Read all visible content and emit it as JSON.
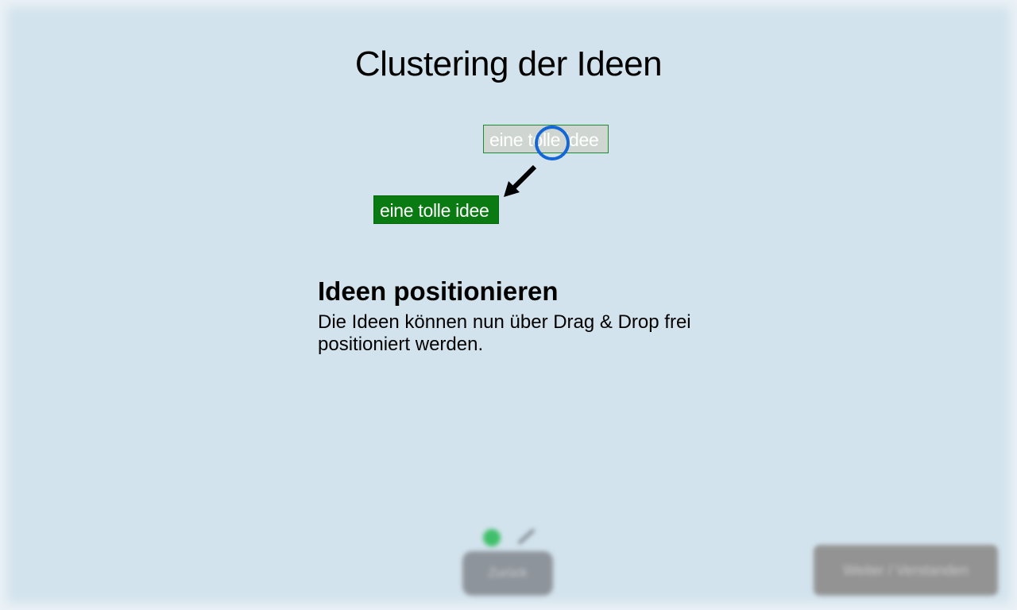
{
  "header": {
    "title": "Clustering der Ideen"
  },
  "demo": {
    "ghost_idea_label": "eine tolle idee",
    "placed_idea_label": "eine tolle idee"
  },
  "instructions": {
    "heading": "Ideen positionieren",
    "body": "Die Ideen können nun über Drag & Drop frei positioniert werden."
  },
  "footer": {
    "back_label": "Zurück",
    "next_label": "Weiter / Verstanden"
  },
  "colors": {
    "background": "#d3e3ed",
    "idea_green": "#0a7a12",
    "cursor_blue": "#1366d6",
    "progress_active": "#3fbf6a"
  },
  "icons": {
    "cursor": "circle-cursor-icon",
    "drag_arrow": "arrow-down-left-icon"
  }
}
